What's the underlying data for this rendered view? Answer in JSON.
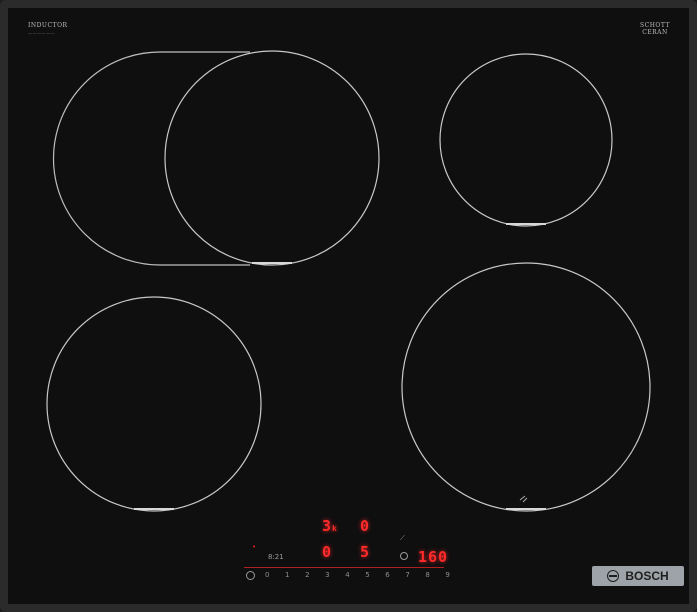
{
  "hob": {
    "top_left_label": "INDUCTOR",
    "top_right_label_line1": "SCHOTT",
    "top_right_label_line2": "CERAN"
  },
  "brand": {
    "name": "BOSCH"
  },
  "display": {
    "zone_top_value": "3",
    "zone_top_sub": "k",
    "zone_top_right": "0",
    "zone_bottom_left": "0",
    "zone_bottom_mid": "5",
    "timer_value": "160",
    "misc_left": "8:21"
  },
  "power_scale": [
    "0",
    "1",
    "2",
    "3",
    "4",
    "5",
    "6",
    "7",
    "8",
    "9"
  ],
  "colors": {
    "display_red": "#ff2a2a",
    "badge_gray": "#9da3a8"
  }
}
